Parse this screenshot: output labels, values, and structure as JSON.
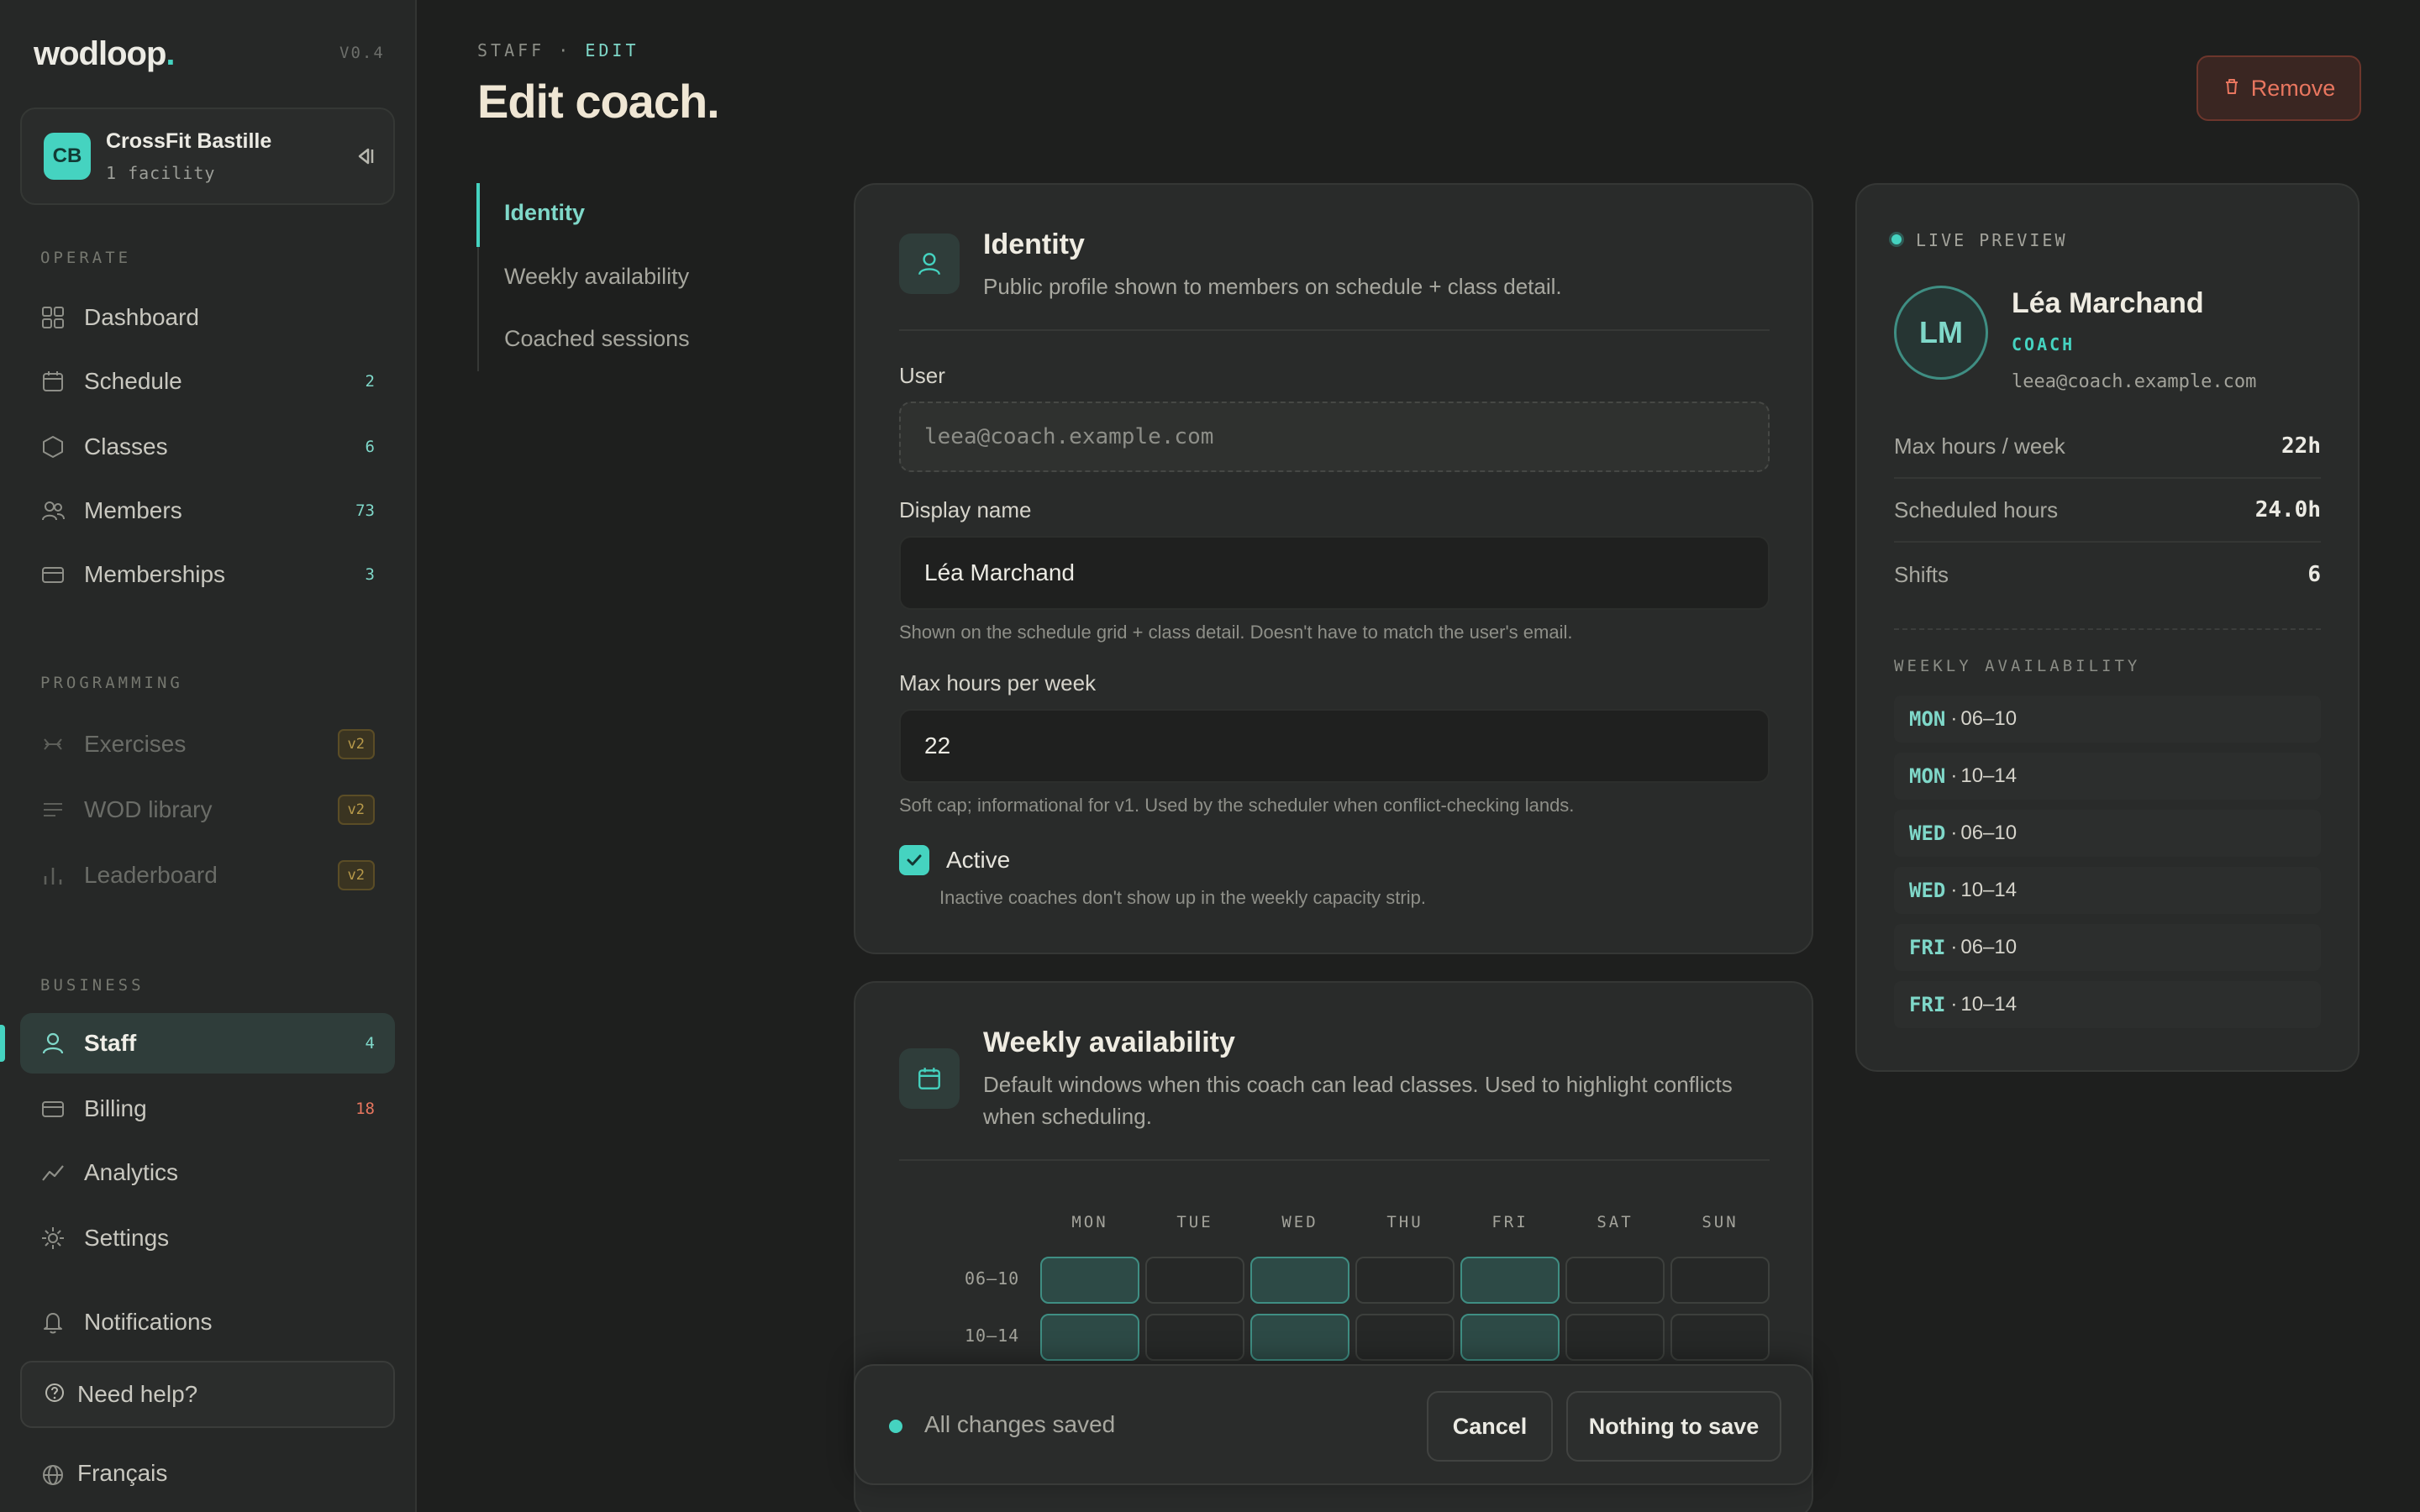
{
  "app": {
    "brand": "wodloop",
    "brand_dot": ".",
    "version": "V0.4"
  },
  "org": {
    "initials": "CB",
    "name": "CrossFit Bastille",
    "sub": "1 facility"
  },
  "sidebar": {
    "operate_label": "OPERATE",
    "operate": [
      {
        "label": "Dashboard",
        "count": ""
      },
      {
        "label": "Schedule",
        "count": "2"
      },
      {
        "label": "Classes",
        "count": "6"
      },
      {
        "label": "Members",
        "count": "73"
      },
      {
        "label": "Memberships",
        "count": "3"
      }
    ],
    "programming_label": "PROGRAMMING",
    "programming": [
      {
        "label": "Exercises",
        "badge": "v2"
      },
      {
        "label": "WOD library",
        "badge": "v2"
      },
      {
        "label": "Leaderboard",
        "badge": "v2"
      }
    ],
    "business_label": "BUSINESS",
    "business": [
      {
        "label": "Staff",
        "count": "4"
      },
      {
        "label": "Billing",
        "count": "18"
      },
      {
        "label": "Analytics",
        "count": ""
      },
      {
        "label": "Settings",
        "count": ""
      }
    ],
    "notifications": "Notifications",
    "help": "Need help?",
    "language": "Français"
  },
  "header": {
    "crumb_parent": "STAFF",
    "crumb_sep": " · ",
    "crumb_current": "EDIT",
    "title": "Edit coach.",
    "remove": "Remove"
  },
  "section_nav": [
    "Identity",
    "Weekly availability",
    "Coached sessions"
  ],
  "identity": {
    "title": "Identity",
    "desc": "Public profile shown to members on schedule + class detail.",
    "user_label": "User",
    "user_value": "leea@coach.example.com",
    "display_label": "Display name",
    "display_value": "Léa Marchand",
    "display_hint": "Shown on the schedule grid + class detail. Doesn't have to match the user's email.",
    "hours_label": "Max hours per week",
    "hours_value": "22",
    "hours_hint": "Soft cap; informational for v1. Used by the scheduler when conflict-checking lands.",
    "active_label": "Active",
    "active_checked": true,
    "active_hint": "Inactive coaches don't show up in the weekly capacity strip."
  },
  "availability": {
    "title": "Weekly availability",
    "desc_line1": "Default windows when this coach can lead classes. Used to highlight conflicts",
    "desc_line2": "when scheduling.",
    "days": [
      "MON",
      "TUE",
      "WED",
      "THU",
      "FRI",
      "SAT",
      "SUN"
    ],
    "rows": [
      {
        "label": "06–10",
        "on": [
          true,
          false,
          true,
          false,
          true,
          false,
          false
        ]
      },
      {
        "label": "10–14",
        "on": [
          true,
          false,
          true,
          false,
          true,
          false,
          false
        ]
      }
    ]
  },
  "savebar": {
    "status": "All changes saved",
    "cancel": "Cancel",
    "save": "Nothing to save"
  },
  "preview": {
    "live_label": "LIVE PREVIEW",
    "initials": "LM",
    "name": "Léa Marchand",
    "role": "COACH",
    "email": "leea@coach.example.com",
    "stats": [
      {
        "key": "Max hours / week",
        "value": "22h"
      },
      {
        "key": "Scheduled hours",
        "value": "24.0h"
      },
      {
        "key": "Shifts",
        "value": "6"
      }
    ],
    "avail_label": "WEEKLY AVAILABILITY",
    "avail": [
      {
        "day": "MON",
        "sep": " · ",
        "time": "06–10"
      },
      {
        "day": "MON",
        "sep": " · ",
        "time": "10–14"
      },
      {
        "day": "WED",
        "sep": " · ",
        "time": "06–10"
      },
      {
        "day": "WED",
        "sep": " · ",
        "time": "10–14"
      },
      {
        "day": "FRI",
        "sep": " · ",
        "time": "06–10"
      },
      {
        "day": "FRI",
        "sep": " · ",
        "time": "10–14"
      }
    ]
  },
  "colors": {
    "accent": "#45d3c0",
    "danger": "#e8765f",
    "warning": "#b89a4a",
    "background": "#1e1f1e"
  }
}
